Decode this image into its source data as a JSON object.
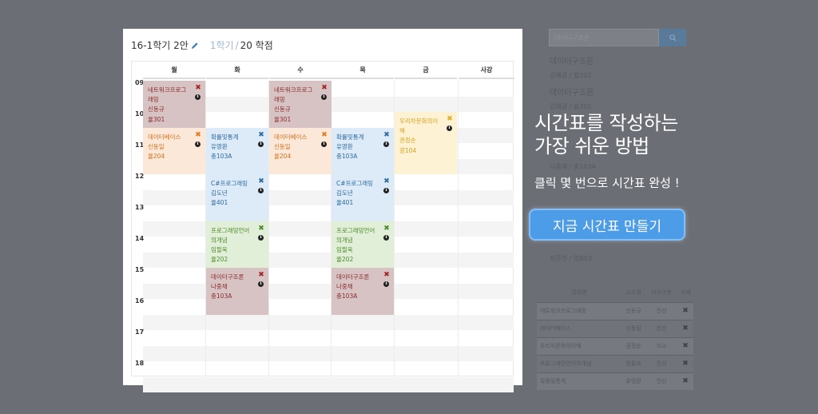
{
  "background_panel": {
    "search_placeholder": "데이터구조론",
    "courses": [
      {
        "name": "데이터구조론",
        "meta": "김혜광 / 율202"
      },
      {
        "name": "데이터구조론",
        "meta": "김혜광 / 율202"
      },
      {
        "name": "",
        "meta": "나중채 / 충103A"
      },
      {
        "name": "",
        "meta": "최준연 / 영B03"
      }
    ],
    "table": {
      "headers": [
        "강의명",
        "교수명",
        "이수구분",
        "삭제"
      ],
      "rows": [
        {
          "name": "네트워크프로그래밍",
          "prof": "신동규",
          "type": "전선",
          "del": "✖"
        },
        {
          "name": "데이터베이스",
          "prof": "신동일",
          "type": "전선",
          "del": "✖"
        },
        {
          "name": "우리차문화의이해",
          "prof": "권정순",
          "type": "지교",
          "del": "✖"
        },
        {
          "name": "프로그래밍언어의개념",
          "prof": "임필욱",
          "type": "전선",
          "del": "✖"
        },
        {
          "name": "확률및통계",
          "prof": "유영환",
          "type": "전선",
          "del": "✖"
        }
      ]
    }
  },
  "promo": {
    "headline_1": "시간표를 작성하는",
    "headline_2": "가장 쉬운 방법",
    "subtitle": "클릭 몇 번으로 시간표 완성 !",
    "cta_label": "지금 시간표 만들기"
  },
  "timetable": {
    "title": "16-1학기 2안",
    "semester": "1학기",
    "slash": "/",
    "credits": "20 학점",
    "days": [
      "월",
      "화",
      "수",
      "목",
      "금",
      "사강"
    ],
    "hours": [
      "09",
      "10",
      "11",
      "12",
      "13",
      "14",
      "15",
      "16",
      "17",
      "18"
    ],
    "lectures": [
      {
        "lines": [
          "네트워크프로그",
          "래밍",
          "신동규",
          "율301"
        ],
        "color": "red"
      },
      {
        "lines": [
          "네트워크프로그",
          "래밍",
          "신동규",
          "율301"
        ],
        "color": "red"
      },
      {
        "lines": [
          "데이터베이스",
          "신동일",
          "율204"
        ],
        "color": "orange"
      },
      {
        "lines": [
          "데이터베이스",
          "신동일",
          "율204"
        ],
        "color": "orange"
      },
      {
        "lines": [
          "확률및통계",
          "유영환",
          "충103A"
        ],
        "color": "blue"
      },
      {
        "lines": [
          "확률및통계",
          "유영환",
          "충103A"
        ],
        "color": "blue"
      },
      {
        "lines": [
          "우리차문화의이",
          "해",
          "권정순",
          "광104"
        ],
        "color": "yellow"
      },
      {
        "lines": [
          "C#프로그래밍",
          "김도년",
          "율401"
        ],
        "color": "blue"
      },
      {
        "lines": [
          "C#프로그래밍",
          "김도년",
          "율401"
        ],
        "color": "blue"
      },
      {
        "lines": [
          "프로그래밍언어",
          "의개념",
          "임필욱",
          "율202"
        ],
        "color": "green"
      },
      {
        "lines": [
          "프로그래밍언어",
          "의개념",
          "임필욱",
          "율202"
        ],
        "color": "green"
      },
      {
        "lines": [
          "데이터구조론",
          "나중채",
          "충103A"
        ],
        "color": "red"
      },
      {
        "lines": [
          "데이터구조론",
          "나중채",
          "충103A"
        ],
        "color": "red"
      }
    ],
    "delete_symbol": "✖",
    "info_symbol": "i",
    "accent_colors": {
      "red": "#d8c3c4",
      "orange": "#fbe8d8",
      "blue": "#dcebf7",
      "yellow": "#fdf2d4",
      "green": "#e1efd8"
    }
  }
}
